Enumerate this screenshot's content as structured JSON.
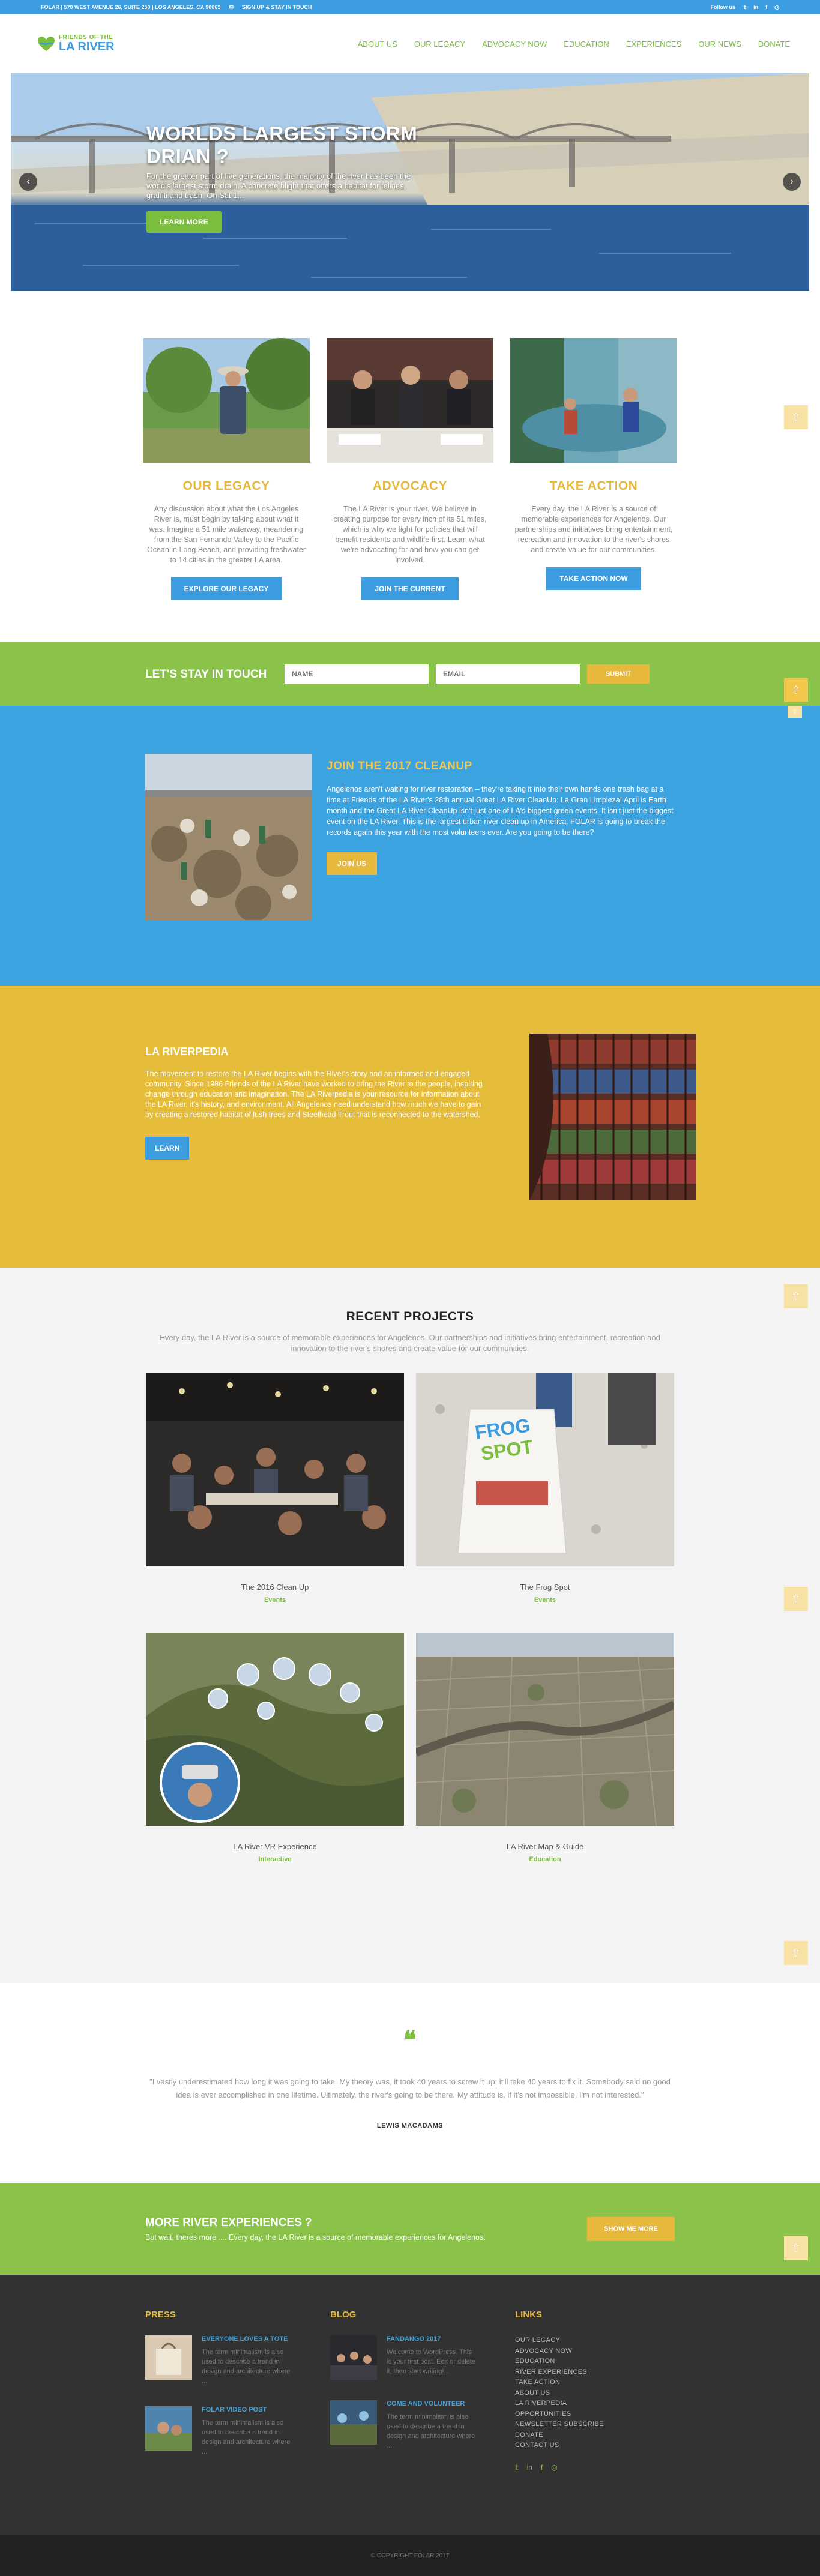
{
  "topbar": {
    "address": "FOLAR | 570 WEST AVENUE 26, SUITE 250 | LOS ANGELES, CA 90065",
    "signup": "SIGN UP & STAY IN TOUCH",
    "follow": "Follow us"
  },
  "header": {
    "logo_top": "FRIENDS OF THE",
    "logo_bottom": "LA RIVER",
    "nav": [
      "ABOUT US",
      "OUR LEGACY",
      "ADVOCACY NOW",
      "EDUCATION",
      "EXPERIENCES",
      "OUR NEWS",
      "DONATE"
    ]
  },
  "hero": {
    "title": "WORLDS LARGEST STORM DRIAN ?",
    "text": "For the greater part of five generations, the majority of the river has been the world's largest storm drain. A concrete blight that offers a habitat for felines, graffiti and trash. On Sat 1...",
    "button": "LEARN MORE"
  },
  "features": [
    {
      "title": "OUR LEGACY",
      "text": "Any discussion about what the Los Angeles River is, must begin by talking about what it was. Imagine a 51 mile waterway, meandering from the San Fernando Valley to the Pacific Ocean in Long Beach, and providing freshwater to 14 cities in the greater LA area.",
      "button": "EXPLORE OUR LEGACY"
    },
    {
      "title": "ADVOCACY",
      "text": "The LA River is your river. We believe in creating purpose for every inch of its 51 miles, which is why we fight for policies that will benefit residents and wildlife first. Learn what we're advocating for and how you can get involved.",
      "button": "JOIN THE CURRENT"
    },
    {
      "title": "TAKE ACTION",
      "text": "Every day, the LA River is a source of memorable experiences for Angelenos. Our partnerships and initiatives bring entertainment, recreation and innovation to the river's shores and create value for our communities.",
      "button": "TAKE ACTION NOW"
    }
  ],
  "subscribe": {
    "label": "LET'S STAY IN TOUCH",
    "name_placeholder": "NAME",
    "email_placeholder": "EMAIL",
    "submit": "SUBMIT"
  },
  "cleanup": {
    "title": "JOIN THE 2017 CLEANUP",
    "text": "Angelenos aren't waiting for river restoration – they're taking it into their own hands one trash bag at a time at Friends of the LA River's 28th annual Great LA River CleanUp: La Gran Limpieza! April is Earth month and the Great LA River CleanUp isn't just one of LA's biggest green events. It isn't just the biggest event on the LA River. This is the largest urban river clean up in America. FOLAR is going to break the records again this year with the most volunteers ever. Are you going to be there?",
    "button": "JOIN US"
  },
  "riverpedia": {
    "title": "LA RIVERPEDIA",
    "text": "The movement to restore the LA River begins with the River's story and an informed and engaged community. Since 1986 Friends of the LA River have worked to bring the River to the people, inspiring change through education and imagination. The LA Riverpedia is your resource for information about the LA River, it's history, and environment. All Angelenos need understand how much we have to gain by creating a restored habitat of lush trees and Steelhead Trout that is reconnected to the watershed.",
    "button": "LEARN"
  },
  "projects": {
    "title": "RECENT PROJECTS",
    "lead": "Every day, the LA River is a source of memorable experiences for Angelenos. Our partnerships and initiatives bring entertainment, recreation and innovation to the river's shores and create value for our communities.",
    "items": [
      {
        "title": "The 2016 Clean Up",
        "category": "Events"
      },
      {
        "title": "The Frog Spot",
        "category": "Events"
      },
      {
        "title": "LA River VR Experience",
        "category": "Interactive"
      },
      {
        "title": "LA River Map & Guide",
        "category": "Education"
      }
    ],
    "sign_line1": "FROG",
    "sign_line2": "SPOT"
  },
  "testimonial": {
    "quote_mark": "❝",
    "text": "\"I vastly underestimated how long it was going to take. My theory was, it took 40 years to screw it up; it'll take 40 years to fix it. Somebody said no good idea is ever accomplished in one lifetime. Ultimately, the river's going to be there. My attitude is, if it's not impossible, I'm not interested.\"",
    "author": "LEWIS MACADAMS"
  },
  "more": {
    "title": "MORE RIVER EXPERIENCES ?",
    "text": "But wait, theres more .... Every day, the LA River is a source of memorable experiences for Angelenos.",
    "button": "SHOW ME MORE"
  },
  "footer": {
    "press_title": "PRESS",
    "press": [
      {
        "title": "EVERYONE LOVES A TOTE",
        "text": "The term minimalism is also used to describe a trend in design and architecture where ..."
      },
      {
        "title": "FOLAR VIDEO POST",
        "text": "The term minimalism is also used to describe a trend in design and architecture where ..."
      }
    ],
    "blog_title": "BLOG",
    "blog": [
      {
        "title": "FANDANGO 2017",
        "text": "Welcome to WordPress. This is your first post. Edit or delete it, then start writing!..."
      },
      {
        "title": "COME AND VOLUNTEER",
        "text": "The term minimalism is also used to describe a trend in design and architecture where ..."
      }
    ],
    "links_title": "LINKS",
    "links": [
      "OUR LEGACY",
      "ADVOCACY NOW",
      "EDUCATION",
      "RIVER EXPERIENCES",
      "TAKE ACTION",
      "ABOUT US",
      "LA RIVERPEDIA",
      "OPPORTUNITIES",
      "NEWSLETTER SUBSCRIBE",
      "DONATE",
      "CONTACT US"
    ],
    "copyright": "© COPYRIGHT FOLAR 2017"
  },
  "colors": {
    "blue": "#3b9de0",
    "green": "#8bc34a",
    "yellow": "#e6b83c",
    "dark": "#323232"
  }
}
